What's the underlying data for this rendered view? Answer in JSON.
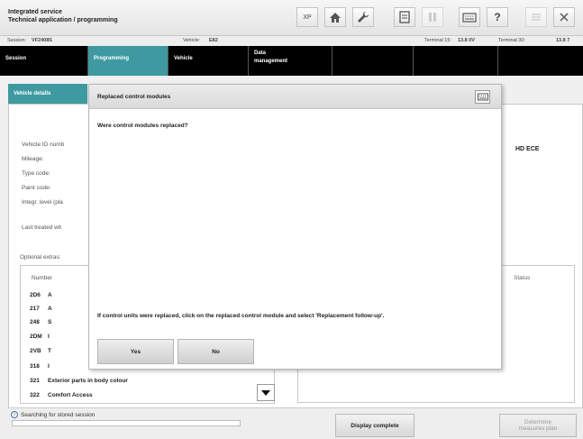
{
  "app": {
    "title_line1": "Integrated service",
    "title_line2": "Technical application / programming"
  },
  "toolbar": [
    {
      "name": "xp-button",
      "glyph": "XP",
      "dim": false
    },
    {
      "name": "home-button",
      "glyph": "⌂",
      "dim": false
    },
    {
      "name": "wrench-button",
      "glyph": "🔧",
      "dim": false
    },
    {
      "name": "document-button",
      "glyph": "🗎",
      "dim": false
    },
    {
      "name": "pause-button",
      "glyph": "⏸",
      "dim": true
    },
    {
      "name": "keyboard-button",
      "glyph": "⌨",
      "dim": false
    },
    {
      "name": "help-button",
      "glyph": "?",
      "dim": false
    },
    {
      "name": "minimize-button",
      "glyph": "—",
      "dim": true
    },
    {
      "name": "close-button",
      "glyph": "✕",
      "dim": false
    }
  ],
  "infobar": {
    "session_label": "Session:",
    "session_value": "VF2408S",
    "vehicle_label": "Vehicle:",
    "vehicle_value": "E82",
    "terminal15_label": "Terminal 15:",
    "terminal15_value": "13.8 0V",
    "terminal30_label": "Terminal 30:",
    "terminal30_value": "13.8 7"
  },
  "nav": {
    "session": "Session",
    "programming": "Programming",
    "vehicle": "Vehicle",
    "data_management_1": "Data",
    "data_management_2": "management"
  },
  "subtab": "Vehicle details",
  "details": {
    "vehicle_id": "Vehicle ID numb",
    "mileage": "Mileage:",
    "type_code": "Type code:",
    "paint_code": "Paint code:",
    "integ_level": "Integr. level (pla",
    "last_treated": "Last treated wit",
    "ece_value": "HD ECE"
  },
  "optional_extras": {
    "label": "Optional extras:",
    "col_number": "Number",
    "col_status": "Status",
    "rows": [
      {
        "number": "2D6",
        "desc": "A"
      },
      {
        "number": "217",
        "desc": "A"
      },
      {
        "number": "248",
        "desc": "S"
      },
      {
        "number": "2DM",
        "desc": "I"
      },
      {
        "number": "2VB",
        "desc": "T"
      },
      {
        "number": "318",
        "desc": "I"
      },
      {
        "number": "321",
        "desc": "Exterior parts in body colour"
      },
      {
        "number": "322",
        "desc": "Comfort Access"
      }
    ]
  },
  "footer": {
    "search_msg": "Searching for stored session",
    "display_complete": "Display complete",
    "determine_1": "Determine",
    "determine_2": "measures plan"
  },
  "dialog": {
    "title": "Replaced control modules",
    "question": "Were control modules replaced?",
    "hint": "If control units were replaced, click on the replaced control module and select 'Replacement follow-up'.",
    "yes": "Yes",
    "no": "No"
  }
}
